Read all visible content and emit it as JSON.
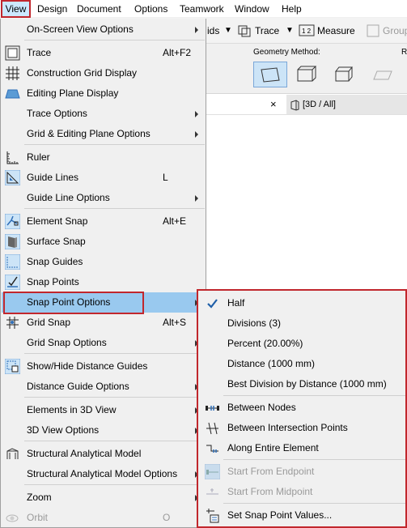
{
  "menubar": {
    "items": [
      "View",
      "Design",
      "Document",
      "Options",
      "Teamwork",
      "Window",
      "Help"
    ]
  },
  "toolbar": {
    "ids_label": "ids",
    "trace_label": "Trace",
    "measure_label": "Measure",
    "group_label": "Group",
    "geometry_method": "Geometry Method:",
    "r_label": "R"
  },
  "view_tab": {
    "label": "[3D / All]",
    "close_glyph": "×"
  },
  "view_menu": {
    "items": [
      {
        "label": "On-Screen View Options",
        "shortcut": "",
        "submenu": true,
        "icon": "none"
      },
      {
        "label": "Trace",
        "shortcut": "Alt+F2",
        "submenu": false,
        "icon": "trace-icon"
      },
      {
        "label": "Construction Grid Display",
        "shortcut": "",
        "submenu": false,
        "icon": "construction-grid-icon"
      },
      {
        "label": "Editing Plane Display",
        "shortcut": "",
        "submenu": false,
        "icon": "editing-plane-icon"
      },
      {
        "label": "Trace Options",
        "shortcut": "",
        "submenu": true,
        "icon": "none"
      },
      {
        "label": "Grid & Editing Plane Options",
        "shortcut": "",
        "submenu": true,
        "icon": "none"
      },
      {
        "label": "Ruler",
        "shortcut": "",
        "submenu": false,
        "icon": "ruler-icon"
      },
      {
        "label": "Guide Lines",
        "shortcut": "L",
        "submenu": false,
        "icon": "guide-lines-icon"
      },
      {
        "label": "Guide Line Options",
        "shortcut": "",
        "submenu": true,
        "icon": "none"
      },
      {
        "label": "Element Snap",
        "shortcut": "Alt+E",
        "submenu": false,
        "icon": "element-snap-icon"
      },
      {
        "label": "Surface Snap",
        "shortcut": "",
        "submenu": false,
        "icon": "surface-snap-icon"
      },
      {
        "label": "Snap Guides",
        "shortcut": "",
        "submenu": false,
        "icon": "snap-guides-icon"
      },
      {
        "label": "Snap Points",
        "shortcut": "",
        "submenu": false,
        "icon": "snap-points-icon"
      },
      {
        "label": "Snap Point Options",
        "shortcut": "",
        "submenu": true,
        "icon": "none"
      },
      {
        "label": "Grid Snap",
        "shortcut": "Alt+S",
        "submenu": false,
        "icon": "grid-snap-icon"
      },
      {
        "label": "Grid Snap Options",
        "shortcut": "",
        "submenu": true,
        "icon": "none"
      },
      {
        "label": "Show/Hide Distance Guides",
        "shortcut": "",
        "submenu": false,
        "icon": "distance-guides-icon"
      },
      {
        "label": "Distance Guide Options",
        "shortcut": "",
        "submenu": true,
        "icon": "none"
      },
      {
        "label": "Elements in 3D View",
        "shortcut": "",
        "submenu": true,
        "icon": "none"
      },
      {
        "label": "3D View Options",
        "shortcut": "",
        "submenu": true,
        "icon": "none"
      },
      {
        "label": "Structural Analytical Model",
        "shortcut": "",
        "submenu": false,
        "icon": "structural-model-icon"
      },
      {
        "label": "Structural Analytical Model Options",
        "shortcut": "",
        "submenu": true,
        "icon": "none"
      },
      {
        "label": "Zoom",
        "shortcut": "",
        "submenu": true,
        "icon": "none"
      },
      {
        "label": "Orbit",
        "shortcut": "O",
        "submenu": false,
        "icon": "orbit-icon"
      }
    ]
  },
  "snap_submenu": {
    "items": [
      {
        "label": "Half",
        "icon": "checkmark-icon"
      },
      {
        "label": "Divisions (3)",
        "icon": "none"
      },
      {
        "label": "Percent (20.00%)",
        "icon": "none"
      },
      {
        "label": "Distance (1000 mm)",
        "icon": "none"
      },
      {
        "label": "Best Division by Distance (1000 mm)",
        "icon": "none"
      },
      {
        "label": "Between Nodes",
        "icon": "between-nodes-icon"
      },
      {
        "label": "Between Intersection Points",
        "icon": "intersection-points-icon"
      },
      {
        "label": "Along Entire Element",
        "icon": "entire-element-icon"
      },
      {
        "label": "Start From Endpoint",
        "icon": "start-endpoint-icon"
      },
      {
        "label": "Start From Midpoint",
        "icon": "start-midpoint-icon"
      },
      {
        "label": "Set Snap Point Values...",
        "icon": "snap-values-icon"
      }
    ]
  },
  "colors": {
    "highlight": "#99c9ef",
    "callout_border": "#c1272d",
    "checked_bg": "#cce4f7",
    "icon_blue": "#2f6fb8"
  }
}
